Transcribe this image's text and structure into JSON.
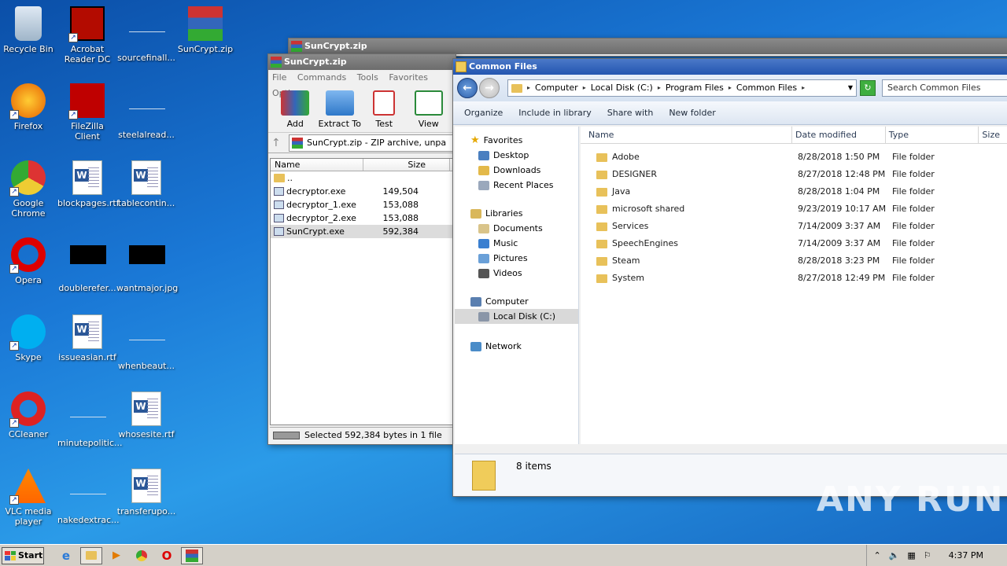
{
  "desktop": {
    "icons": [
      {
        "label": "Recycle Bin"
      },
      {
        "label": "Acrobat Reader DC"
      },
      {
        "label": "sourcefinall..."
      },
      {
        "label": "SunCrypt.zip"
      },
      {
        "label": "Firefox"
      },
      {
        "label": "FileZilla Client"
      },
      {
        "label": "steelalread..."
      },
      {
        "label": "Google Chrome"
      },
      {
        "label": "blockpages.rtf"
      },
      {
        "label": "tablecontin..."
      },
      {
        "label": "Opera"
      },
      {
        "label": "doublerefer..."
      },
      {
        "label": "wantmajor.jpg"
      },
      {
        "label": "Skype"
      },
      {
        "label": "issueasian.rtf"
      },
      {
        "label": "whenbeaut..."
      },
      {
        "label": "CCleaner"
      },
      {
        "label": "minutepolitic..."
      },
      {
        "label": "whosesite.rtf"
      },
      {
        "label": "VLC media player"
      },
      {
        "label": "nakedextrac..."
      },
      {
        "label": "transferupo..."
      }
    ]
  },
  "winrar_back": {
    "title": "SunCrypt.zip"
  },
  "winrar": {
    "title": "SunCrypt.zip",
    "menu": [
      "File",
      "Commands",
      "Tools",
      "Favorites",
      "Options"
    ],
    "toolbar": [
      "Add",
      "Extract To",
      "Test",
      "View"
    ],
    "path": "SunCrypt.zip - ZIP archive, unpa",
    "columns": {
      "name": "Name",
      "size": "Size"
    },
    "files": [
      {
        "name": "..",
        "size": ""
      },
      {
        "name": "decryptor.exe",
        "size": "149,504"
      },
      {
        "name": "decryptor_1.exe",
        "size": "153,088"
      },
      {
        "name": "decryptor_2.exe",
        "size": "153,088"
      },
      {
        "name": "SunCrypt.exe",
        "size": "592,384"
      }
    ],
    "status": "Selected 592,384 bytes in 1 file"
  },
  "explorer": {
    "title": "Common Files",
    "breadcrumb": [
      "Computer",
      "Local Disk (C:)",
      "Program Files",
      "Common Files"
    ],
    "search_placeholder": "Search Common Files",
    "commands": [
      "Organize",
      "Include in library",
      "Share with",
      "New folder"
    ],
    "nav": {
      "favorites": "Favorites",
      "favorites_items": [
        "Desktop",
        "Downloads",
        "Recent Places"
      ],
      "libraries": "Libraries",
      "libraries_items": [
        "Documents",
        "Music",
        "Pictures",
        "Videos"
      ],
      "computer": "Computer",
      "computer_items": [
        "Local Disk (C:)"
      ],
      "network": "Network"
    },
    "columns": {
      "name": "Name",
      "date": "Date modified",
      "type": "Type",
      "size": "Size"
    },
    "rows": [
      {
        "name": "Adobe",
        "date": "8/28/2018 1:50 PM",
        "type": "File folder"
      },
      {
        "name": "DESIGNER",
        "date": "8/27/2018 12:48 PM",
        "type": "File folder"
      },
      {
        "name": "Java",
        "date": "8/28/2018 1:04 PM",
        "type": "File folder"
      },
      {
        "name": "microsoft shared",
        "date": "9/23/2019 10:17 AM",
        "type": "File folder"
      },
      {
        "name": "Services",
        "date": "7/14/2009 3:37 AM",
        "type": "File folder"
      },
      {
        "name": "SpeechEngines",
        "date": "7/14/2009 3:37 AM",
        "type": "File folder"
      },
      {
        "name": "Steam",
        "date": "8/28/2018 3:23 PM",
        "type": "File folder"
      },
      {
        "name": "System",
        "date": "8/27/2018 12:49 PM",
        "type": "File folder"
      }
    ],
    "item_count": "8 items"
  },
  "taskbar": {
    "start": "Start",
    "clock": "4:37 PM"
  },
  "watermark": "ANY RUN"
}
